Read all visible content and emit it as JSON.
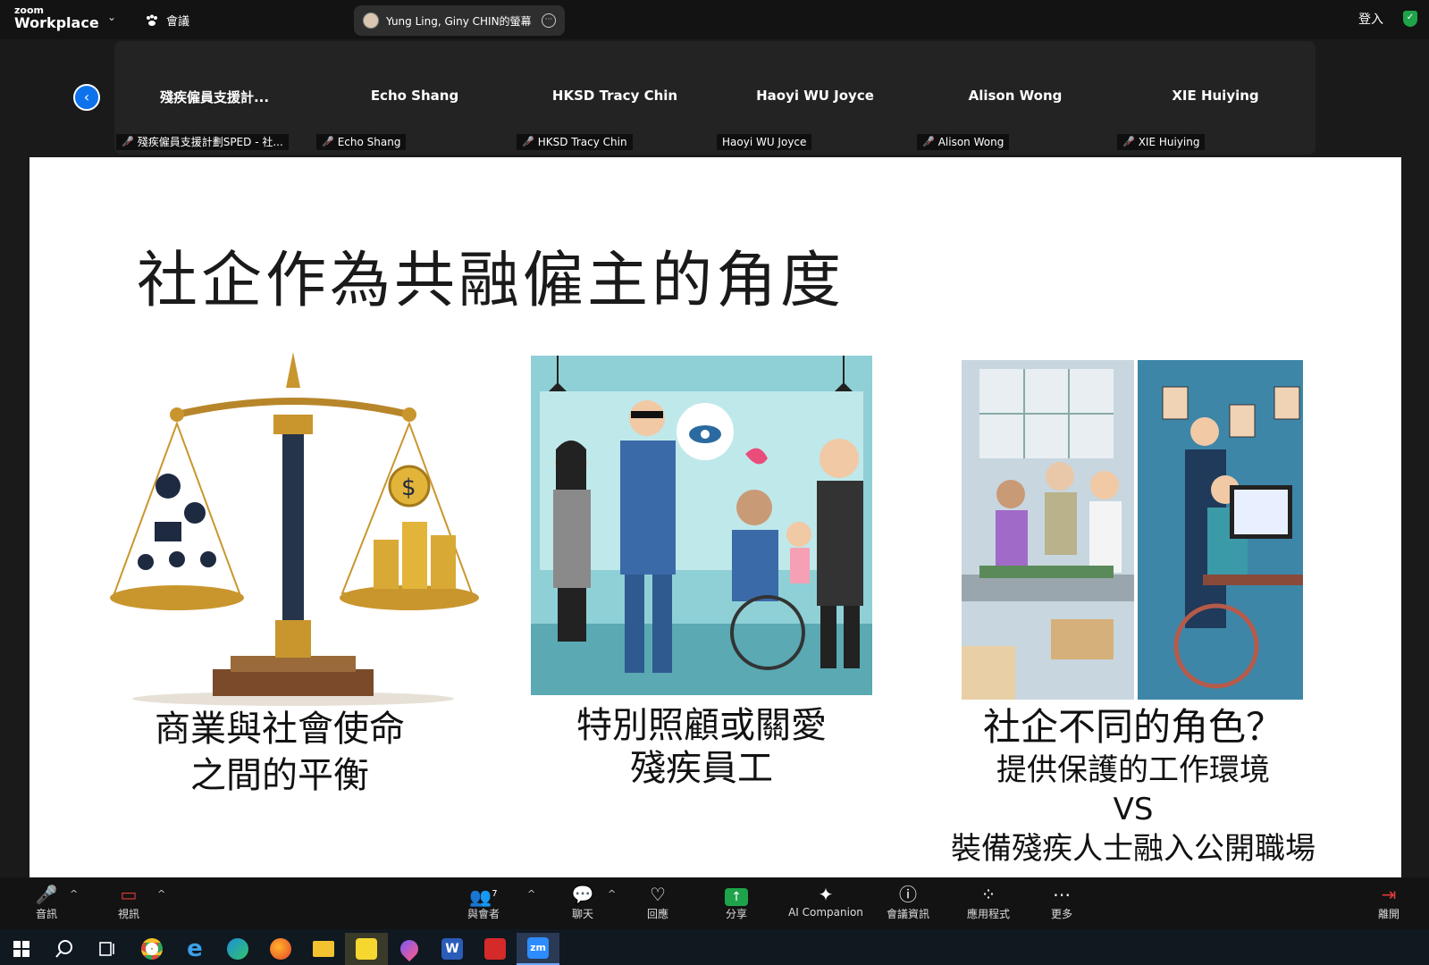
{
  "topbar": {
    "logo_small": "zoom",
    "logo_big": "Workplace",
    "meeting_label": "會議",
    "share_title": "Yung Ling, Giny CHIN的螢幕",
    "signin": "登入"
  },
  "participants": [
    {
      "name": "殘疾僱員支援計...",
      "tag": "殘疾僱員支援計劃SPED - 社...",
      "muted": true
    },
    {
      "name": "Echo Shang",
      "tag": "Echo Shang",
      "muted": true
    },
    {
      "name": "HKSD Tracy Chin",
      "tag": "HKSD Tracy Chin",
      "muted": true
    },
    {
      "name": "Haoyi WU Joyce",
      "tag": "Haoyi WU Joyce",
      "muted": false
    },
    {
      "name": "Alison Wong",
      "tag": "Alison Wong",
      "muted": true
    },
    {
      "name": "XIE Huiying",
      "tag": "XIE Huiying",
      "muted": true
    }
  ],
  "slide": {
    "title": "社企作為共融僱主的角度",
    "captions": {
      "c1_line1": "商業與社會使命",
      "c1_line2": "之間的平衡",
      "c2_line1": "特別照顧或關愛",
      "c2_line2": "殘疾員工",
      "c3_line1": "社企不同的角色？",
      "c3_line2": "提供保護的工作環境",
      "c3_line3": "VS",
      "c3_line4": "裝備殘疾人士融入公開職場"
    }
  },
  "toolbar": {
    "audio": "音訊",
    "video": "視訊",
    "participants": "與會者",
    "participants_count": "7",
    "chat": "聊天",
    "react": "回應",
    "share": "分享",
    "ai": "AI Companion",
    "info": "會議資訊",
    "apps": "應用程式",
    "more": "更多",
    "leave": "離開"
  },
  "colors": {
    "accent_blue": "#0e72ed",
    "share_green": "#1fa34a",
    "muted_red": "#e03a3a"
  }
}
